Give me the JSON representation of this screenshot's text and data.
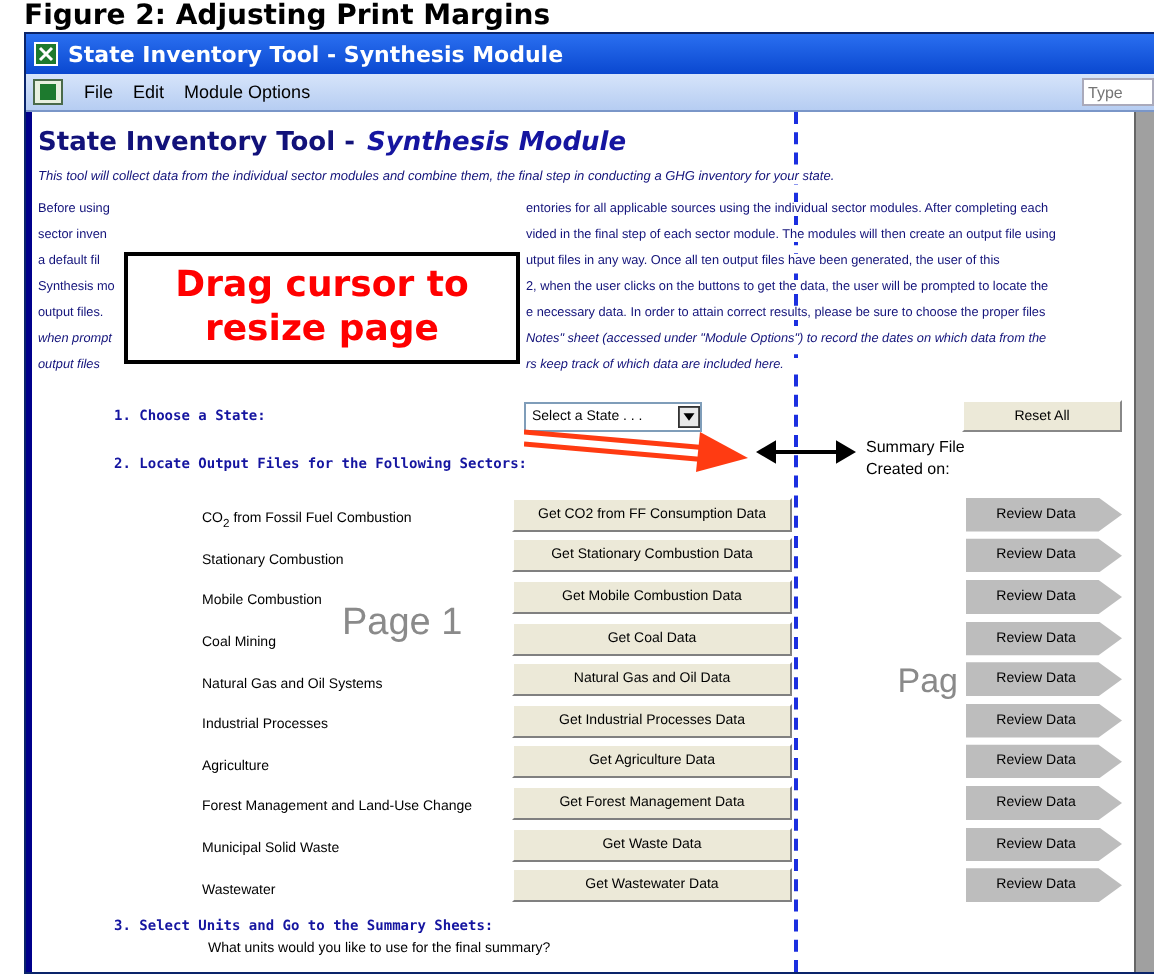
{
  "figure_title": "Figure 2: Adjusting Print Margins",
  "window": {
    "title": "State Inventory Tool - Synthesis Module"
  },
  "menu": [
    "File",
    "Edit",
    "Module Options"
  ],
  "help_search": {
    "placeholder": "Type"
  },
  "heading": {
    "main": "State Inventory Tool -",
    "module": "Synthesis Module"
  },
  "intro": "This tool will collect data from the individual sector modules and combine them, the final step in conducting a GHG inventory for your state.",
  "paragraph_lines": [
    {
      "left": "Before using",
      "right": "entories for all applicable sources using the individual sector modules. After completing each",
      "italic": false
    },
    {
      "left": "sector inven",
      "right": "vided in the final step of each sector module. The modules will then create an output file using",
      "italic": false
    },
    {
      "left": "a default fil",
      "right": "utput files in any way. Once all ten output files have been generated, the user of this",
      "italic": false
    },
    {
      "left": "Synthesis mo",
      "right": "2, when the user clicks on the buttons to get the data, the user will be prompted to locate the",
      "italic": false
    },
    {
      "left": "output files.",
      "right": "e necessary data. In order to attain correct results, please be sure to choose the proper files",
      "italic": false
    },
    {
      "left": "when prompt",
      "right": "Notes\" sheet (accessed under \"Module Options\") to record the dates on which data from the",
      "italic": true
    },
    {
      "left": "output files",
      "right": "rs keep track of which data are included here.",
      "italic": true
    }
  ],
  "callout": "Drag cursor to resize page",
  "state_select": {
    "label": "1. Choose a State:",
    "value": "Select a State . . ."
  },
  "reset_button": "Reset All",
  "summary_label": [
    "Summary File",
    "Created on:"
  ],
  "sectors": {
    "title": "2. Locate Output Files for the Following Sectors:",
    "rows": [
      {
        "label": "CO$_{2}$ from Fossil Fuel Combustion",
        "get_button": "Get CO2 from FF Consumption Data",
        "review_button": "Review Data"
      },
      {
        "label": "Stationary Combustion",
        "get_button": "Get Stationary Combustion Data",
        "review_button": "Review Data"
      },
      {
        "label": "Mobile Combustion",
        "get_button": "Get Mobile Combustion Data",
        "review_button": "Review Data"
      },
      {
        "label": "Coal Mining",
        "get_button": "Get Coal Data",
        "review_button": "Review Data"
      },
      {
        "label": "Natural Gas and Oil Systems",
        "get_button": "Natural Gas and Oil Data",
        "review_button": "Review Data"
      },
      {
        "label": "Industrial Processes",
        "get_button": "Get Industrial Processes Data",
        "review_button": "Review Data"
      },
      {
        "label": "Agriculture",
        "get_button": "Get Agriculture Data",
        "review_button": "Review Data"
      },
      {
        "label": "Forest Management and Land-Use Change",
        "get_button": "Get Forest Management Data",
        "review_button": "Review Data"
      },
      {
        "label": "Municipal Solid Waste",
        "get_button": "Get Waste Data",
        "review_button": "Review Data"
      },
      {
        "label": "Wastewater",
        "get_button": "Get Wastewater Data",
        "review_button": "Review Data"
      }
    ]
  },
  "units": {
    "title": "3. Select Units and Go to the Summary Sheets:",
    "question": "What units would you like to use for the final summary?"
  },
  "page_marks": [
    "Page 1",
    "Pag"
  ]
}
